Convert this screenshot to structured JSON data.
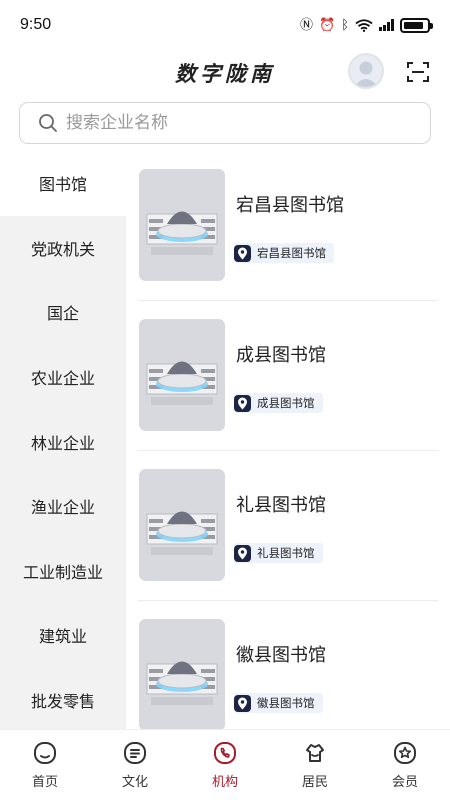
{
  "status_bar": {
    "time": "9:50",
    "battery_level": 0.85
  },
  "header": {
    "title": "数字陇南"
  },
  "search": {
    "placeholder": "搜索企业名称"
  },
  "sidebar": {
    "items": [
      {
        "label": "图书馆",
        "active": true
      },
      {
        "label": "党政机关"
      },
      {
        "label": "国企"
      },
      {
        "label": "农业企业"
      },
      {
        "label": "林业企业"
      },
      {
        "label": "渔业企业"
      },
      {
        "label": "工业制造业"
      },
      {
        "label": "建筑业"
      },
      {
        "label": "批发零售"
      }
    ]
  },
  "list": {
    "items": [
      {
        "title": "宕昌县图书馆",
        "tag": "宕昌县图书馆"
      },
      {
        "title": "成县图书馆",
        "tag": "成县图书馆"
      },
      {
        "title": "礼县图书馆",
        "tag": "礼县图书馆"
      },
      {
        "title": "徽县图书馆",
        "tag": "徽县图书馆"
      }
    ]
  },
  "bottom_nav": {
    "items": [
      {
        "label": "首页",
        "icon": "home-icon"
      },
      {
        "label": "文化",
        "icon": "culture-icon"
      },
      {
        "label": "机构",
        "icon": "organization-icon",
        "active": true
      },
      {
        "label": "居民",
        "icon": "resident-icon"
      },
      {
        "label": "会员",
        "icon": "member-icon"
      }
    ]
  },
  "colors": {
    "accent": "#a61c2a",
    "tag_icon_bg": "#1d2547",
    "sidebar_bg": "#f2f2f2"
  }
}
